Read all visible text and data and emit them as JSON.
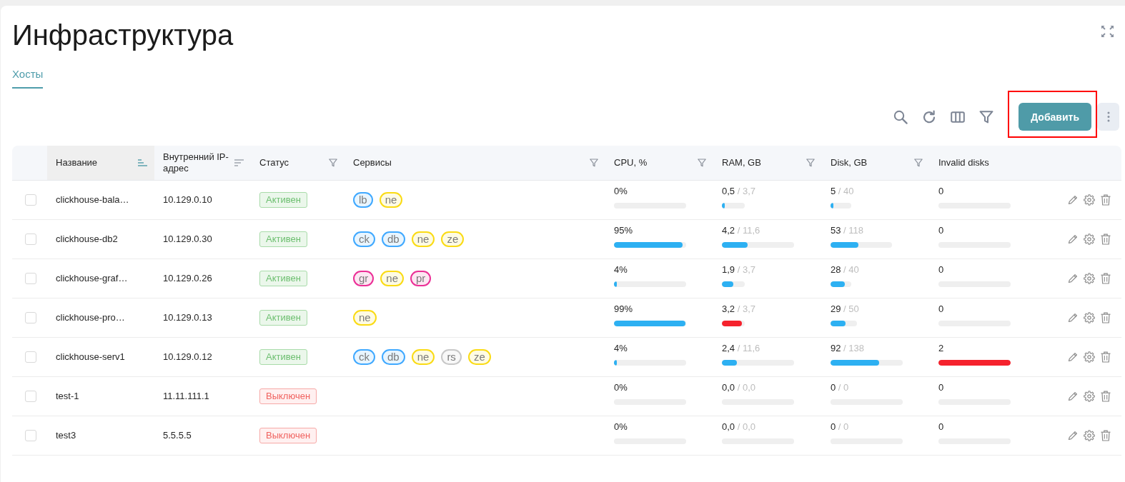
{
  "page": {
    "title": "Инфраструктура",
    "tabs": [
      {
        "label": "Хосты",
        "selected": true
      }
    ]
  },
  "toolbar": {
    "add_button": {
      "label": "Добавить",
      "highlighted": true
    }
  },
  "table": {
    "columns": [
      {
        "label": "Название",
        "kind": "sort",
        "sorted": true
      },
      {
        "label": "Внутренний IP-адрес",
        "kind": "sort",
        "sorted": false
      },
      {
        "label": "Статус",
        "kind": "filter",
        "sorted": false
      },
      {
        "label": "Сервисы",
        "kind": "filter",
        "sorted": false
      },
      {
        "label": "CPU, %",
        "kind": "filter",
        "sorted": false
      },
      {
        "label": "RAM, GB",
        "kind": "filter",
        "sorted": false
      },
      {
        "label": "Disk, GB",
        "kind": "filter",
        "sorted": false
      },
      {
        "label": "Invalid disks",
        "sorted": false
      }
    ],
    "rows": [
      {
        "checked": false,
        "name": "clickhouse-bala…",
        "ip": "10.129.0.10",
        "status": {
          "label": "Активен",
          "kind": "active"
        },
        "services": [
          {
            "label": "lb",
            "color": "#40a9ff"
          },
          {
            "label": "ne",
            "color": "#fadb14"
          }
        ],
        "cpu": {
          "value": "0%",
          "level": 0
        },
        "ram": {
          "value": "0,5",
          "total": "/ 3,7",
          "level": 0.135,
          "critical": false
        },
        "disk": {
          "value": "5",
          "total": "/ 40",
          "level": 0.125,
          "critical": false
        },
        "invalid_disks": {
          "value": "0",
          "level": 0
        }
      },
      {
        "checked": false,
        "name": "clickhouse-db2",
        "ip": "10.129.0.30",
        "status": {
          "label": "Активен",
          "kind": "active"
        },
        "services": [
          {
            "label": "ck",
            "color": "#40a9ff"
          },
          {
            "label": "db",
            "color": "#40a9ff"
          },
          {
            "label": "ne",
            "color": "#fadb14"
          },
          {
            "label": "ze",
            "color": "#fadb14"
          }
        ],
        "cpu": {
          "value": "95%",
          "level": 0.95,
          "critical": false
        },
        "ram": {
          "value": "4,2",
          "total": "/ 11,6",
          "level": 0.36,
          "critical": false
        },
        "disk": {
          "value": "53",
          "total": "/ 118",
          "level": 0.45,
          "critical": false
        },
        "invalid_disks": {
          "value": "0",
          "level": 0
        }
      },
      {
        "checked": false,
        "name": "clickhouse-graf…",
        "ip": "10.129.0.26",
        "status": {
          "label": "Активен",
          "kind": "active"
        },
        "services": [
          {
            "label": "gr",
            "color": "#eb2f96"
          },
          {
            "label": "ne",
            "color": "#fadb14"
          },
          {
            "label": "pr",
            "color": "#eb2f96"
          }
        ],
        "cpu": {
          "value": "4%",
          "level": 0.04,
          "critical": false
        },
        "ram": {
          "value": "1,9",
          "total": "/ 3,7",
          "level": 0.51,
          "critical": false
        },
        "disk": {
          "value": "28",
          "total": "/ 40",
          "level": 0.7,
          "critical": false
        },
        "invalid_disks": {
          "value": "0",
          "level": 0
        }
      },
      {
        "checked": false,
        "name": "clickhouse-pro…",
        "ip": "10.129.0.13",
        "status": {
          "label": "Активен",
          "kind": "active"
        },
        "services": [
          {
            "label": "ne",
            "color": "#fadb14"
          }
        ],
        "cpu": {
          "value": "99%",
          "level": 0.99,
          "critical": false
        },
        "ram": {
          "value": "3,2",
          "total": "/ 3,7",
          "level": 0.86,
          "critical": true
        },
        "disk": {
          "value": "29",
          "total": "/ 50",
          "level": 0.58,
          "critical": false
        },
        "invalid_disks": {
          "value": "0",
          "level": 0
        }
      },
      {
        "checked": false,
        "name": "clickhouse-serv1",
        "ip": "10.129.0.12",
        "status": {
          "label": "Активен",
          "kind": "active"
        },
        "services": [
          {
            "label": "ck",
            "color": "#40a9ff"
          },
          {
            "label": "db",
            "color": "#40a9ff"
          },
          {
            "label": "ne",
            "color": "#fadb14"
          },
          {
            "label": "rs",
            "color": "#c8c8c8"
          },
          {
            "label": "ze",
            "color": "#fadb14"
          }
        ],
        "cpu": {
          "value": "4%",
          "level": 0.04,
          "critical": false
        },
        "ram": {
          "value": "2,4",
          "total": "/ 11,6",
          "level": 0.21,
          "critical": false
        },
        "disk": {
          "value": "92",
          "total": "/ 138",
          "level": 0.67,
          "critical": false
        },
        "invalid_disks": {
          "value": "2",
          "level": 1,
          "critical": true
        }
      },
      {
        "checked": false,
        "name": "test-1",
        "ip": "11.11.111.1",
        "status": {
          "label": "Выключен",
          "kind": "off"
        },
        "cpu": {
          "value": "0%",
          "level": 0
        },
        "ram": {
          "value": "0,0",
          "total": "/ 0,0",
          "level": 0
        },
        "disk": {
          "value": "0",
          "total": "/ 0",
          "level": 0
        },
        "invalid_disks": {
          "value": "0",
          "level": 0
        }
      },
      {
        "checked": false,
        "name": "test3",
        "ip": "5.5.5.5",
        "status": {
          "label": "Выключен",
          "kind": "off"
        },
        "cpu": {
          "value": "0%",
          "level": 0
        },
        "ram": {
          "value": "0,0",
          "total": "/ 0,0",
          "level": 0
        },
        "disk": {
          "value": "0",
          "total": "/ 0",
          "level": 0
        },
        "invalid_disks": {
          "value": "0",
          "level": 0
        }
      }
    ]
  }
}
